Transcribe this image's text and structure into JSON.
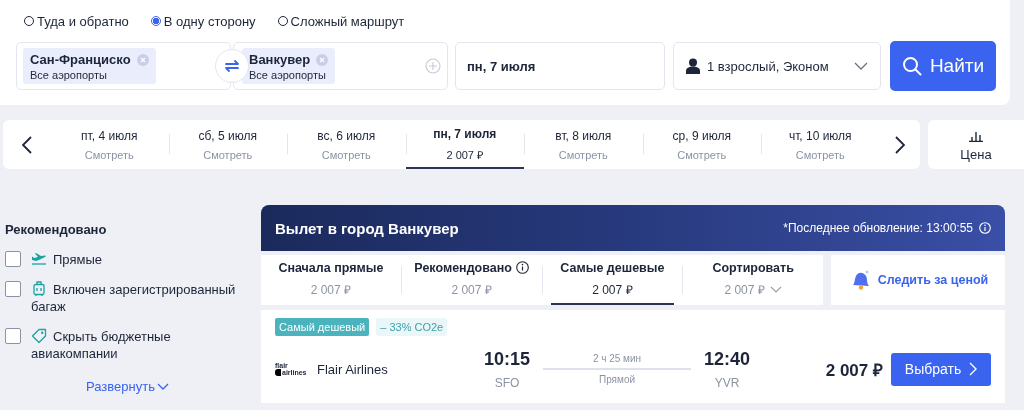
{
  "trip_types": [
    {
      "label": "Туда и обратно",
      "selected": false
    },
    {
      "label": "В одну сторону",
      "selected": true
    },
    {
      "label": "Сложный маршрут",
      "selected": false
    }
  ],
  "search": {
    "origin": {
      "city": "Сан-Франциско",
      "airports": "Все аэропорты"
    },
    "destination": {
      "city": "Ванкувер",
      "airports": "Все аэропорты"
    },
    "date": "пн, 7 июля",
    "passengers": "1 взрослый, Эконом",
    "submit": "Найти"
  },
  "dates": [
    {
      "day": "пт, 4 июля",
      "price": "Смотреть",
      "selected": false
    },
    {
      "day": "сб, 5 июля",
      "price": "Смотреть",
      "selected": false
    },
    {
      "day": "вс, 6 июля",
      "price": "Смотреть",
      "selected": false
    },
    {
      "day": "пн, 7 июля",
      "price": "2 007 ₽",
      "selected": true
    },
    {
      "day": "вт, 8 июля",
      "price": "Смотреть",
      "selected": false
    },
    {
      "day": "ср, 9 июля",
      "price": "Смотреть",
      "selected": false
    },
    {
      "day": "чт, 10 июля",
      "price": "Смотреть",
      "selected": false
    }
  ],
  "price_view": "Цена",
  "filters": {
    "title": "Рекомендовано",
    "items": [
      {
        "label": "Прямые",
        "checked": false,
        "kind": "direct"
      },
      {
        "label": "Включен зарегистрированный багаж",
        "checked": false,
        "kind": "baggage"
      },
      {
        "label": "Скрыть бюджетные авиакомпании",
        "checked": false,
        "kind": "budget"
      }
    ],
    "expand": "Развернуть"
  },
  "results": {
    "title": "Вылет в город Ванкувер",
    "updated": "*Последнее обновление: 13:00:55",
    "sort_tabs": [
      {
        "label": "Сначала прямые",
        "price": "2 007 ₽",
        "selected": false,
        "kind": "plain"
      },
      {
        "label": "Рекомендовано",
        "price": "2 007 ₽",
        "selected": false,
        "kind": "info"
      },
      {
        "label": "Самые дешевые",
        "price": "2 007 ₽",
        "selected": true,
        "kind": "plain"
      },
      {
        "label": "Сортировать",
        "price": "2 007 ₽",
        "selected": false,
        "kind": "dropdown"
      }
    ],
    "track_price": "Следить за ценой",
    "flights": [
      {
        "tags": [
          {
            "label": "Самый дешевый",
            "kind": "cheapest"
          },
          {
            "label": "– 33% CO2e",
            "kind": "eco"
          }
        ],
        "logo": {
          "line1": "flair",
          "line2": "airlines"
        },
        "airline": "Flair Airlines",
        "depart_time": "10:15",
        "depart_code": "SFO",
        "duration": "2 ч 25 мин",
        "stops": "Прямой",
        "arrive_time": "12:40",
        "arrive_code": "YVR",
        "price": "2 007 ₽",
        "select": "Выбрать"
      }
    ]
  }
}
